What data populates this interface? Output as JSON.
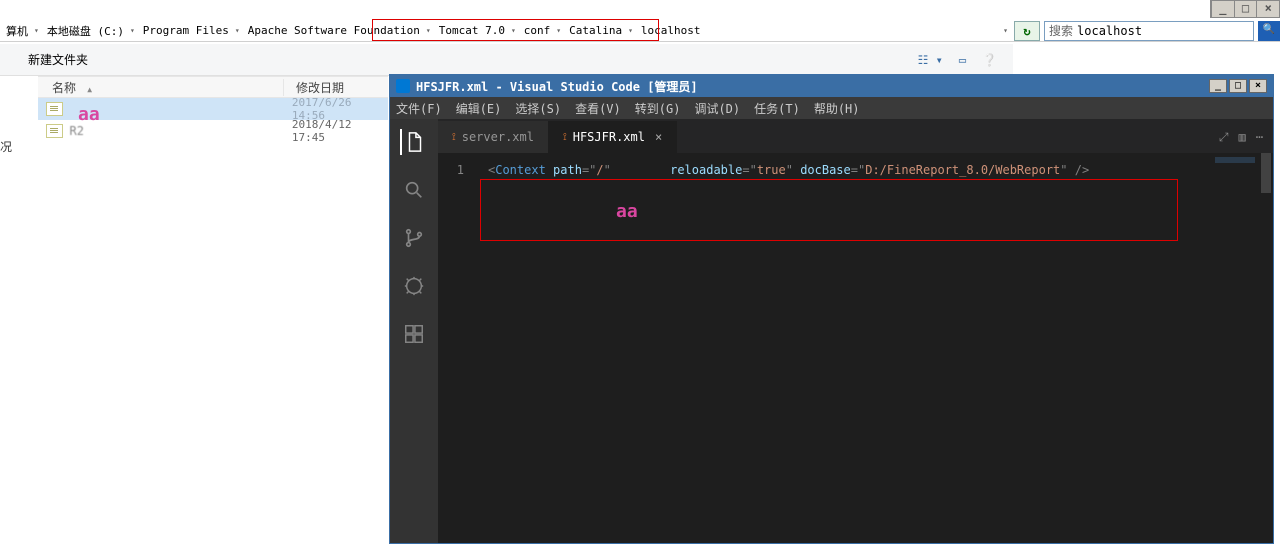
{
  "window_controls": {
    "min": "_",
    "max": "□",
    "close": "×"
  },
  "breadcrumb": {
    "segs": [
      "算机",
      "本地磁盘 (C:)",
      "Program Files",
      "Apache Software Foundation",
      "Tomcat 7.0",
      "conf",
      "Catalina",
      "localhost"
    ],
    "dropdown_marker": "▾"
  },
  "refresh_label": "↻",
  "search": {
    "prefix": "搜索 ",
    "value": "localhost",
    "go": "🔍"
  },
  "toolbar": {
    "new_folder": "新建文件夹"
  },
  "columns": {
    "name": "名称",
    "sort": "▲",
    "date": "修改日期"
  },
  "files": [
    {
      "name": "",
      "date": "2017/6/26 14:56",
      "selected": true
    },
    {
      "name": "   R2",
      "date": "2018/4/12 17:45",
      "selected": false
    }
  ],
  "left_fragment": "况",
  "annotations": {
    "file_aa": "aa",
    "code_aa": "aa"
  },
  "vscode": {
    "title": "HFSJFR.xml - Visual Studio Code [管理员]",
    "menu": [
      "文件(F)",
      "编辑(E)",
      "选择(S)",
      "查看(V)",
      "转到(G)",
      "调试(D)",
      "任务(T)",
      "帮助(H)"
    ],
    "tabs": [
      {
        "label": "server.xml",
        "active": false,
        "closable": false
      },
      {
        "label": "HFSJFR.xml",
        "active": true,
        "closable": true
      }
    ],
    "tab_close": "×",
    "tab_actions": [
      "⤢",
      "▥",
      "⋯"
    ],
    "gutter": "1",
    "code": {
      "open_bracket": "<",
      "tag": "Context",
      "attrs": [
        {
          "name": "path",
          "value": "/"
        },
        {
          "name": "reloadable",
          "value": "true"
        },
        {
          "name": "docBase",
          "value": "D:/FineReport_8.0/WebReport"
        }
      ],
      "close": " />"
    }
  }
}
